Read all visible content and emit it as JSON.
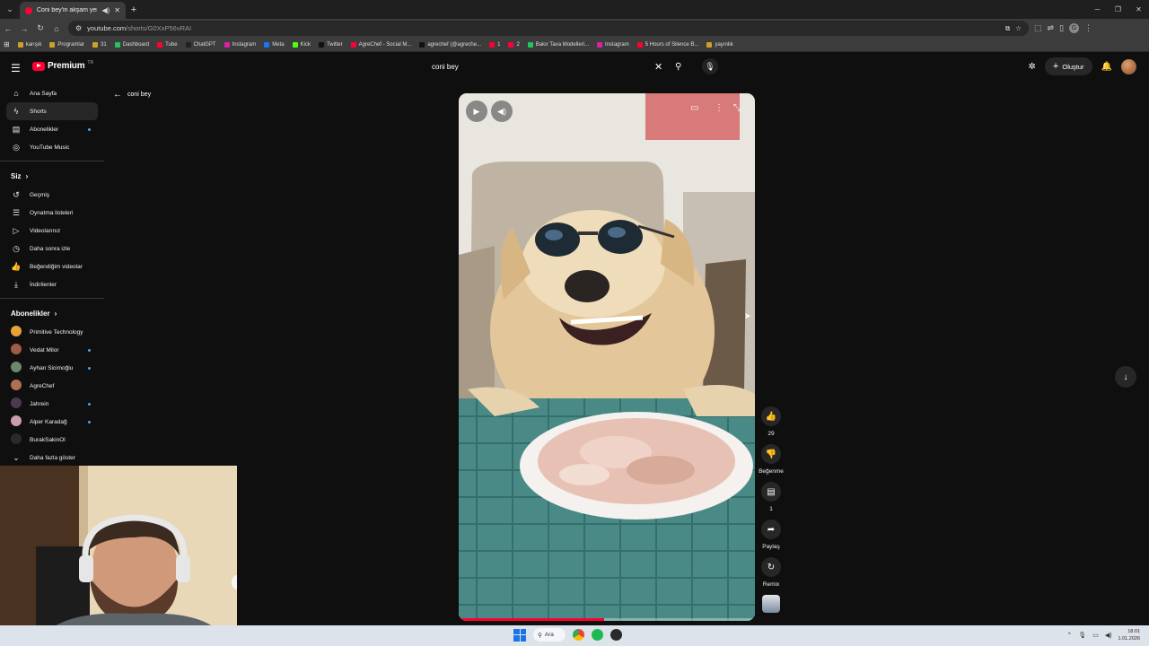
{
  "browser": {
    "tab_title": "Coni bey'in akşam yemeği",
    "url_host": "youtube.com",
    "url_path": "/shorts/G0XxP56vRAI"
  },
  "bookmarks": [
    {
      "label": "karışık",
      "color": "#c9a227"
    },
    {
      "label": "Programlar",
      "color": "#c9a227"
    },
    {
      "label": "31",
      "color": "#c9a227"
    },
    {
      "label": "Dashboard",
      "color": "#22c55e"
    },
    {
      "label": "Tube",
      "color": "#ff0033"
    },
    {
      "label": "ChatGPT",
      "color": "#222222"
    },
    {
      "label": "Instagram",
      "color": "#d6249f"
    },
    {
      "label": "Meta",
      "color": "#1877f2"
    },
    {
      "label": "Kick",
      "color": "#53fc18"
    },
    {
      "label": "Twitter",
      "color": "#111111"
    },
    {
      "label": "AgreChef - Social M...",
      "color": "#ff0033"
    },
    {
      "label": "agrechef (@agreche...",
      "color": "#111111"
    },
    {
      "label": "1",
      "color": "#ff0033"
    },
    {
      "label": "2",
      "color": "#ff0033"
    },
    {
      "label": "Bakır Tava Modelleri...",
      "color": "#22c55e"
    },
    {
      "label": "Instagram",
      "color": "#d6249f"
    },
    {
      "label": "5 Hours of Silence B...",
      "color": "#ff0033"
    },
    {
      "label": "yayınlık",
      "color": "#c9a227"
    }
  ],
  "header": {
    "brand": "Premium",
    "region": "TR",
    "search_query": "coni bey",
    "create_label": "Oluştur"
  },
  "sidebar": {
    "main": [
      {
        "label": "Ana Sayfa",
        "icon": "home-icon",
        "glyph": "⌂"
      },
      {
        "label": "Shorts",
        "icon": "shorts-icon",
        "glyph": "ϟ",
        "active": true
      },
      {
        "label": "Abonelikler",
        "icon": "subscriptions-icon",
        "glyph": "▤",
        "dot": true
      },
      {
        "label": "YouTube Music",
        "icon": "music-icon",
        "glyph": "◎"
      }
    ],
    "you_title": "Siz",
    "you": [
      {
        "label": "Geçmiş",
        "icon": "history-icon",
        "glyph": "↺"
      },
      {
        "label": "Oynatma listeleri",
        "icon": "playlist-icon",
        "glyph": "☰"
      },
      {
        "label": "Videolarınız",
        "icon": "your-videos-icon",
        "glyph": "▷"
      },
      {
        "label": "Daha sonra izle",
        "icon": "watch-later-icon",
        "glyph": "◷"
      },
      {
        "label": "Beğendiğim videolar",
        "icon": "liked-icon",
        "glyph": "👍"
      },
      {
        "label": "İndirilenler",
        "icon": "download-icon",
        "glyph": "⤓"
      }
    ],
    "subs_title": "Abonelikler",
    "subscriptions": [
      {
        "label": "Primitive Technology",
        "color": "#e8a23a",
        "dot": false
      },
      {
        "label": "Vedat Milor",
        "color": "#a05a4a",
        "dot": true
      },
      {
        "label": "Ayhan Sicimoğlu",
        "color": "#6a8a6a",
        "dot": true
      },
      {
        "label": "AgreChef",
        "color": "#b07050",
        "dot": false
      },
      {
        "label": "Jahrein",
        "color": "#4a3a4a",
        "dot": true
      },
      {
        "label": "Alper Karadağ",
        "color": "#c8a0a8",
        "dot": true
      },
      {
        "label": "BurakSakinOl",
        "color": "#2a2a2a",
        "dot": false
      }
    ],
    "show_more": "Daha fazla göster"
  },
  "back_label": "coni bey",
  "actions": {
    "likes": "29",
    "dislike_label": "Beğenme",
    "comments": "1",
    "share_label": "Paylaş",
    "remix_label": "Remix"
  },
  "player": {
    "progress": 0.49
  },
  "taskbar": {
    "search_label": "Ara",
    "time": "18:01",
    "date": "1.01.2026"
  }
}
